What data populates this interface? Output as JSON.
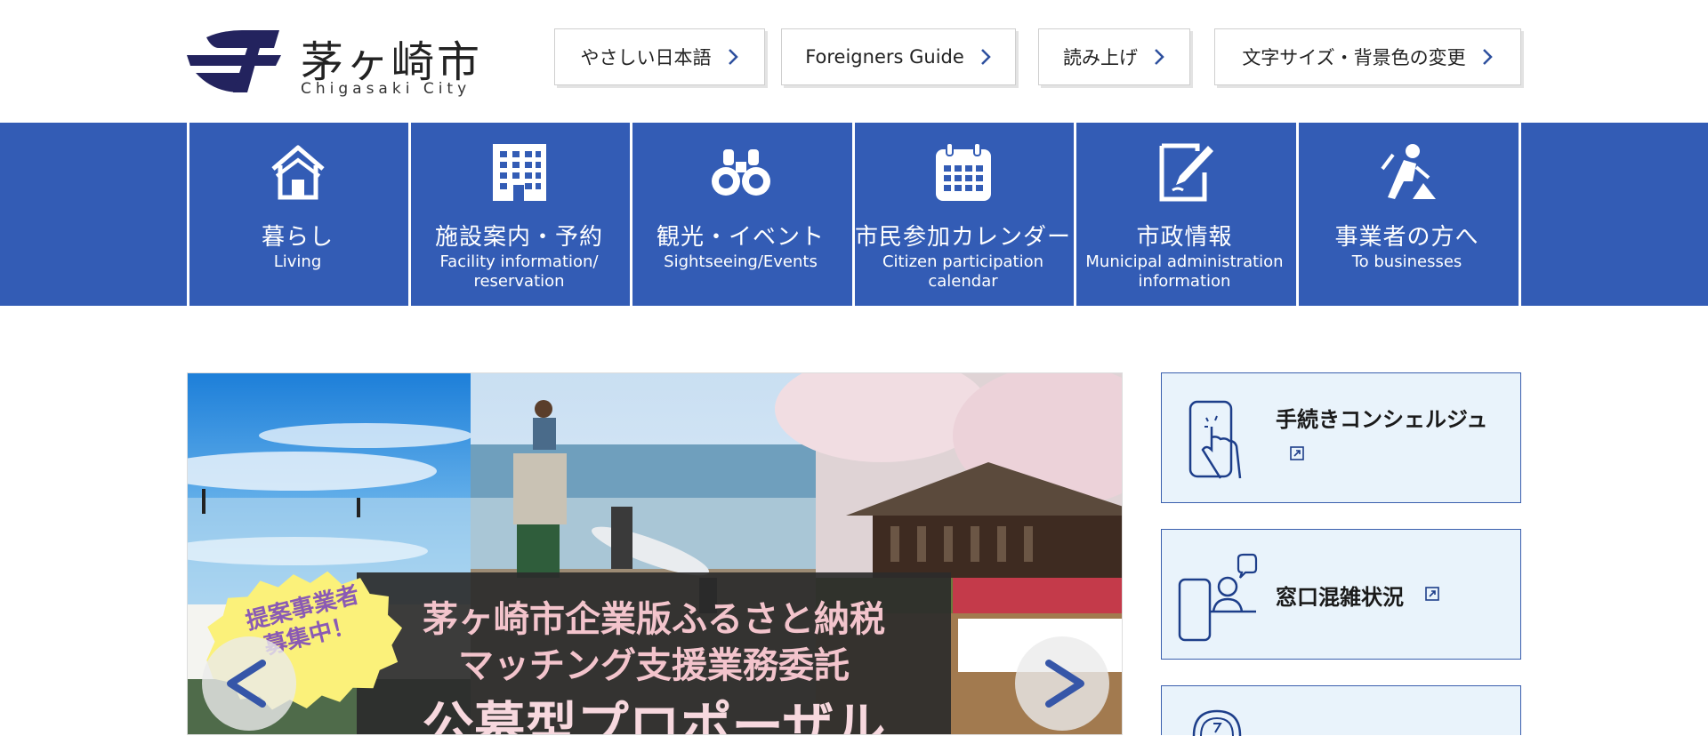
{
  "header": {
    "logo_jp": "茅ヶ崎市",
    "logo_en": "Chigasaki City",
    "buttons": [
      {
        "label": "やさしい日本語"
      },
      {
        "label": "Foreigners Guide"
      },
      {
        "label": "読み上げ"
      },
      {
        "label": "文字サイズ・背景色の変更"
      }
    ]
  },
  "nav": {
    "items": [
      {
        "jp": "暮らし",
        "en": "Living",
        "icon": "house-icon"
      },
      {
        "jp": "施設案内・予約",
        "en": "Facility information/ reservation",
        "icon": "building-icon"
      },
      {
        "jp": "観光・イベント",
        "en": "Sightseeing/Events",
        "icon": "binoculars-icon"
      },
      {
        "jp": "市民参加カレンダー",
        "en": "Citizen participation calendar",
        "icon": "calendar-icon"
      },
      {
        "jp": "市政情報",
        "en": "Municipal administration information",
        "icon": "pen-document-icon"
      },
      {
        "jp": "事業者の方へ",
        "en": "To businesses",
        "icon": "worker-icon"
      }
    ]
  },
  "banner": {
    "badge": "提案事業者募集中！",
    "line1": "茅ヶ崎市企業版ふるさと納税",
    "line2": "マッチング支援業務委託",
    "line3": "公募型プロポーザル"
  },
  "side": {
    "items": [
      {
        "label": "手続きコンシェルジュ",
        "icon": "smartphone-tap-icon"
      },
      {
        "label": "窓口混雑状況",
        "icon": "counter-clerk-icon"
      }
    ]
  },
  "colors": {
    "nav_blue": "#335cb5",
    "logo_navy": "#23235e",
    "side_bg": "#e9f3fb",
    "side_border": "#3a5fae"
  }
}
